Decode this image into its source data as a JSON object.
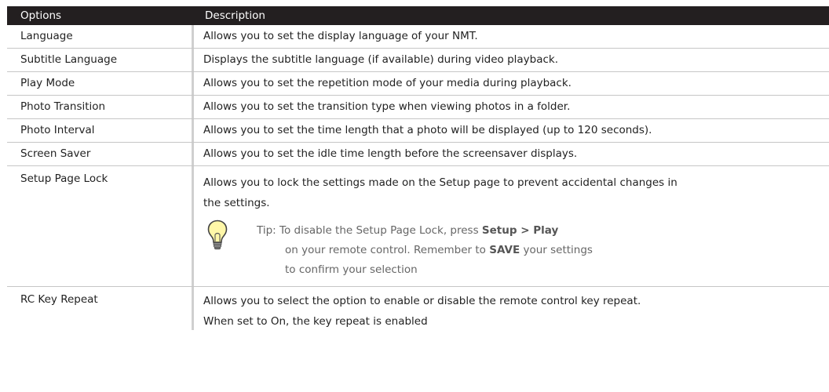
{
  "header": {
    "col1": "Options",
    "col2": "Description"
  },
  "rows": [
    {
      "option": "Language",
      "description": "Allows you to set the display language of your NMT."
    },
    {
      "option": "Subtitle Language",
      "description": "Displays the subtitle language (if available) during video playback."
    },
    {
      "option": "Play Mode",
      "description": "Allows you to set the repetition mode of your media during playback."
    },
    {
      "option": "Photo Transition",
      "description": "Allows you to set the transition type when viewing photos in a folder."
    },
    {
      "option": "Photo Interval",
      "description": "Allows you to set the time length that a photo will be displayed (up to 120 seconds)."
    },
    {
      "option": "Screen Saver",
      "description": "Allows you to set the idle time length before the screensaver displays."
    },
    {
      "option": "Setup Page Lock",
      "description_line1": "Allows you to lock the settings made on the Setup page to prevent accidental changes in",
      "description_line2": "the settings."
    },
    {
      "option": "RC Key Repeat",
      "description_line1": "Allows you to select the option to enable or disable the remote control key repeat.",
      "description_line2": "When set to On, the key repeat is enabled"
    }
  ],
  "tip": {
    "icon": "lightbulb-icon",
    "prefix": "Tip: To disable the Setup Page Lock, press ",
    "bold1": "Setup > Play",
    "line2_pre": "on your remote control. Remember to ",
    "bold2": "SAVE",
    "line2_post": " your settings",
    "line3": "to confirm your selection"
  }
}
